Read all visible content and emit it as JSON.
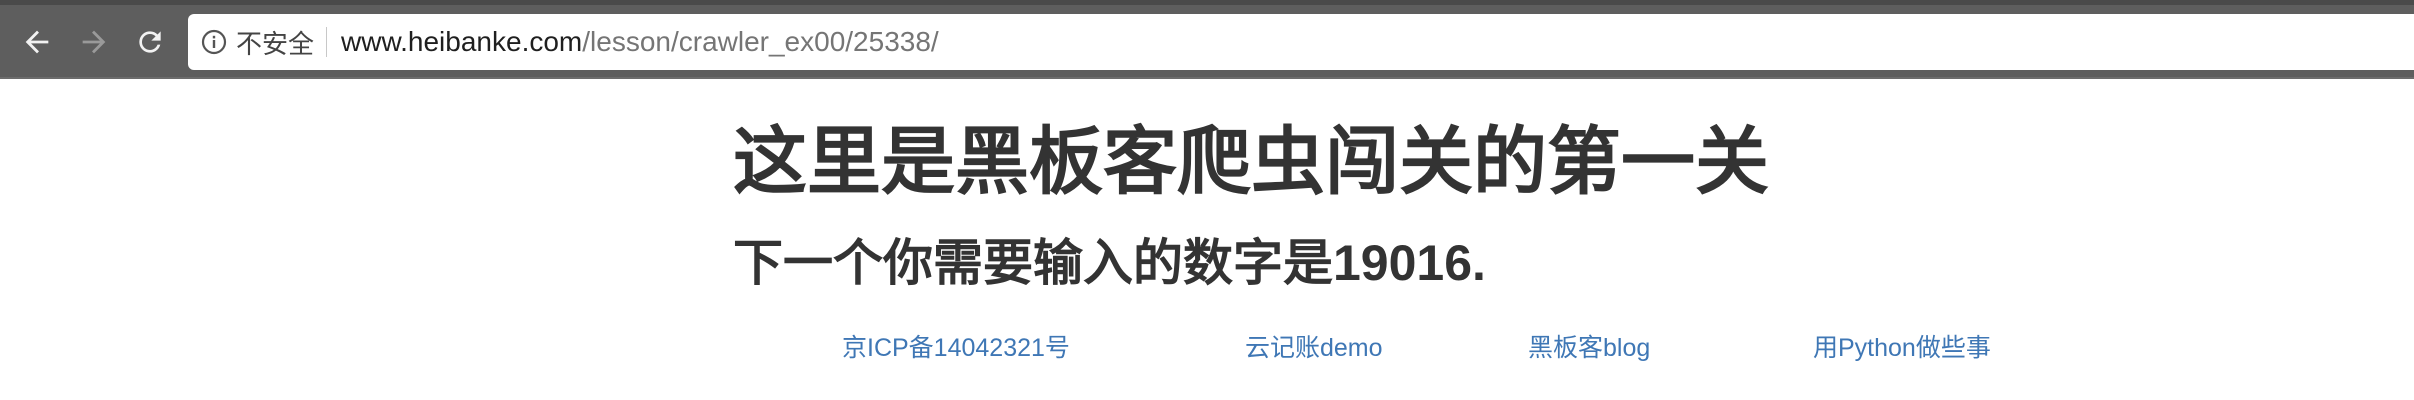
{
  "browser": {
    "security_label": "不安全",
    "url_domain": "www.heibanke.com",
    "url_path": "/lesson/crawler_ex00/25338/",
    "icons": {
      "back": "arrow-left-icon",
      "forward": "arrow-right-icon",
      "reload": "reload-icon",
      "info": "info-icon"
    }
  },
  "page": {
    "title": "这里是黑板客爬虫闯关的第一关",
    "subtitle": "下一个你需要输入的数字是19016."
  },
  "footer": {
    "links": [
      {
        "label": "京ICP备14042321号"
      },
      {
        "label": "云记账demo"
      },
      {
        "label": "黑板客blog"
      },
      {
        "label": "用Python做些事"
      }
    ]
  },
  "colors": {
    "chrome": "#5e5e5e",
    "text": "#333333",
    "link": "#3f77b5"
  }
}
